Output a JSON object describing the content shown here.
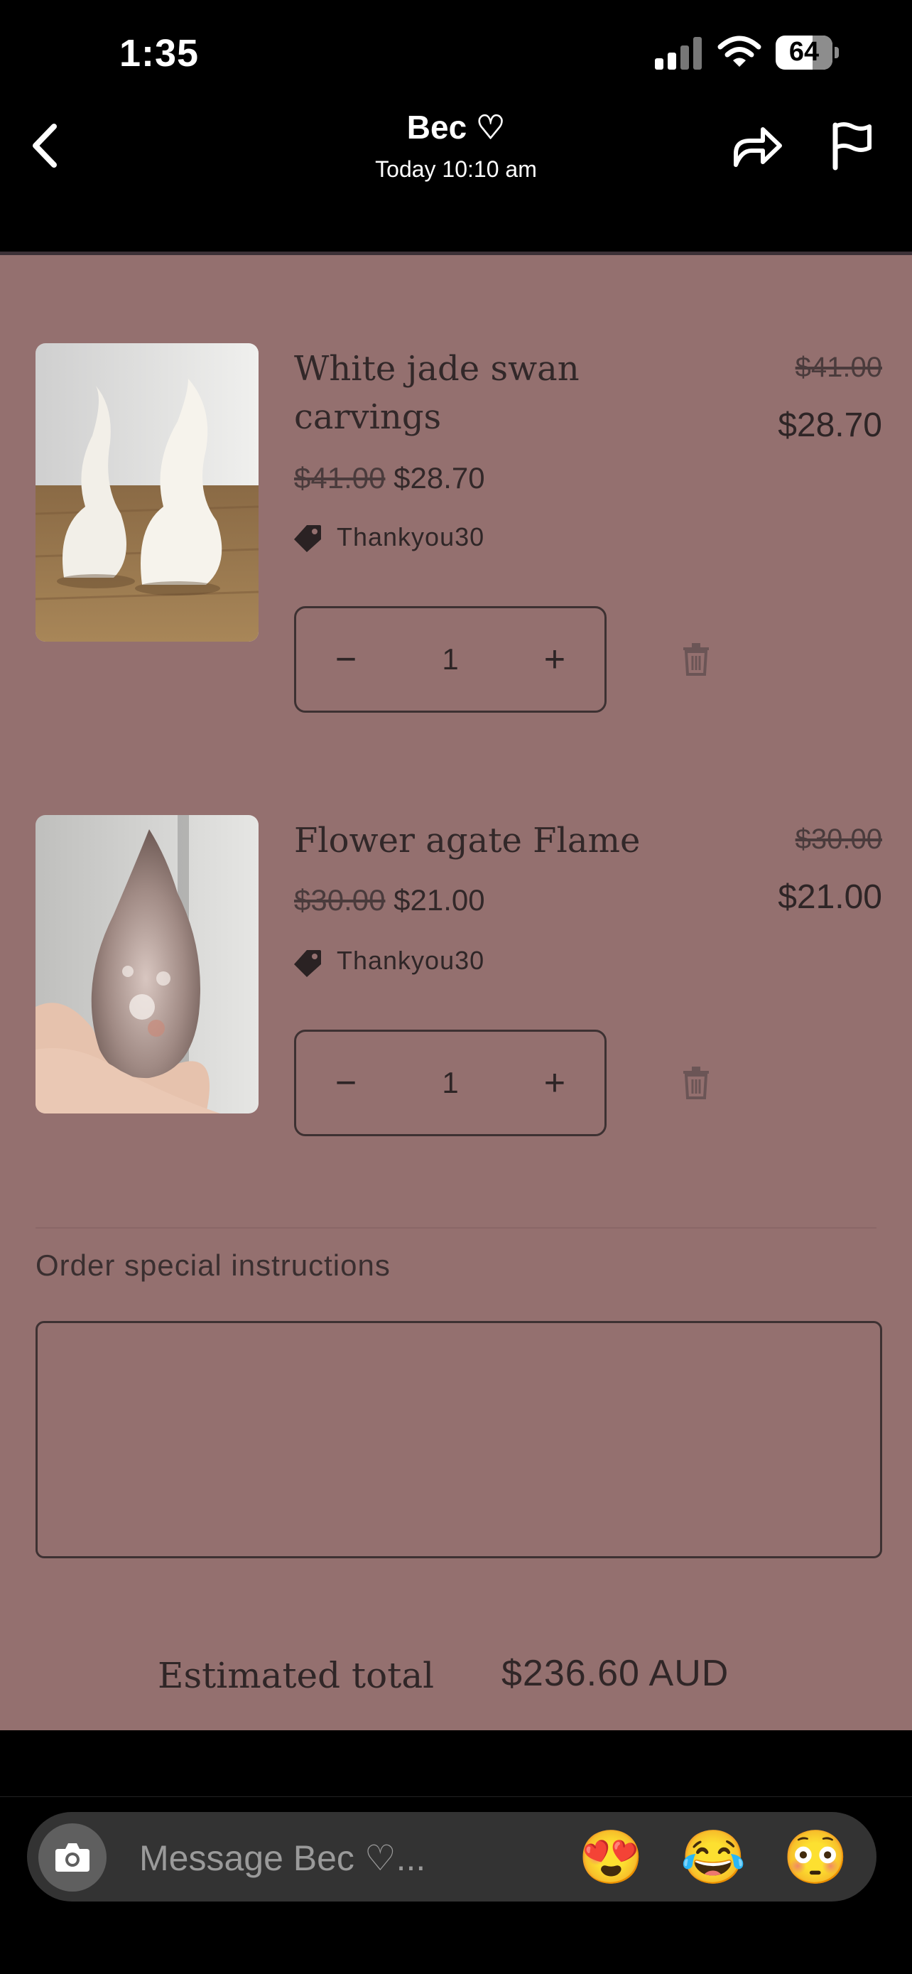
{
  "status_bar": {
    "time": "1:35",
    "battery": "64"
  },
  "header": {
    "contact_name": "Bec ♡",
    "timestamp": "Today 10:10 am"
  },
  "cart": {
    "items": [
      {
        "name_line1": "White jade swan",
        "name_line2": "carvings",
        "original_price": "$41.00",
        "sale_price": "$28.70",
        "discount_code": "Thankyou30",
        "quantity": "1",
        "line_original": "$41.00",
        "line_total": "$28.70"
      },
      {
        "name_line1": "Flower agate Flame",
        "original_price": "$30.00",
        "sale_price": "$21.00",
        "discount_code": "Thankyou30",
        "quantity": "1",
        "line_original": "$30.00",
        "line_total": "$21.00"
      }
    ],
    "qty_minus": "−",
    "qty_plus": "+",
    "instructions_label": "Order special instructions",
    "estimated_total_label": "Estimated total",
    "estimated_total_value": "$236.60 AUD"
  },
  "message_bar": {
    "placeholder": "Message Bec ♡...",
    "reactions": [
      "😍",
      "😂",
      "😳"
    ]
  },
  "colors": {
    "story_background": "#94706f",
    "message_bar": "#333333"
  }
}
